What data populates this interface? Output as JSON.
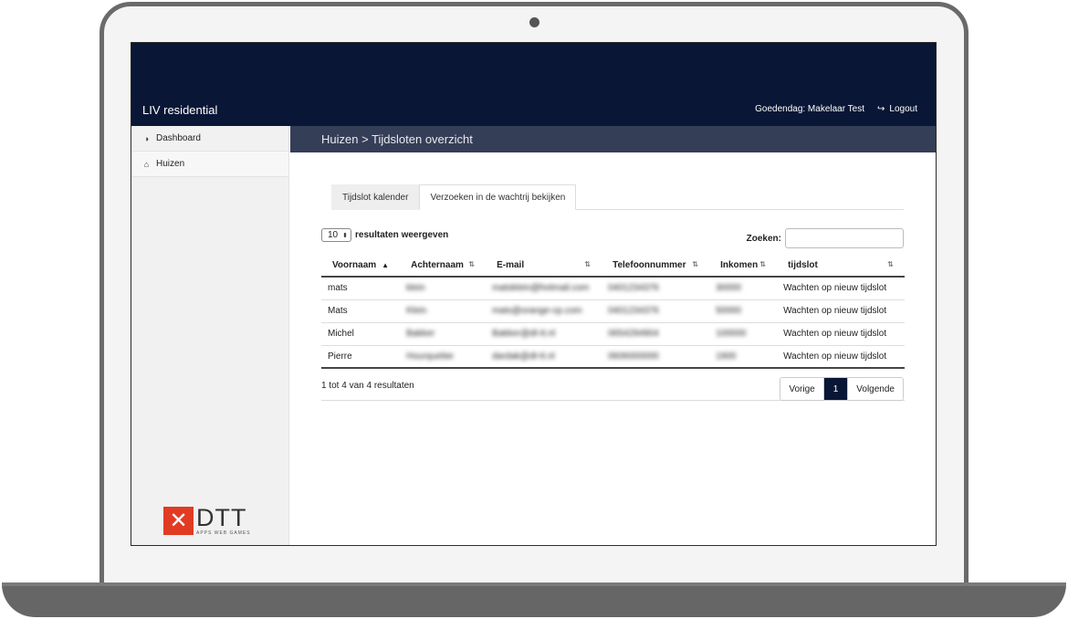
{
  "app": {
    "brand": "LIV residential",
    "greeting": "Goedendag: Makelaar Test",
    "logout_label": "Logout"
  },
  "sidebar": {
    "items": [
      {
        "label": "Dashboard",
        "icon": "dashboard-icon"
      },
      {
        "label": "Huizen",
        "icon": "home-icon"
      }
    ],
    "logo": {
      "text": "DTT",
      "tagline": "APPS WEB GAMES"
    }
  },
  "page": {
    "breadcrumb": "Huizen > Tijdsloten overzicht"
  },
  "tabs": [
    {
      "label": "Tijdslot kalender",
      "active": true
    },
    {
      "label": "Verzoeken in de wachtrij bekijken",
      "active": false
    }
  ],
  "table_controls": {
    "page_length": "10",
    "page_length_label": "resultaten weergeven",
    "search_label": "Zoeken:",
    "search_value": ""
  },
  "table": {
    "columns": [
      "Voornaam",
      "Achternaam",
      "E-mail",
      "Telefoonnummer",
      "Inkomen",
      "tijdslot"
    ],
    "rows": [
      {
        "voornaam": "mats",
        "achternaam": "klein",
        "email": "matsklein@hotmail.com",
        "telefoon": "0401234376",
        "inkomen": "30000",
        "tijdslot": "Wachten op nieuw tijdslot"
      },
      {
        "voornaam": "Mats",
        "achternaam": "Klein",
        "email": "mats@orange-cp.com",
        "telefoon": "0401234376",
        "inkomen": "50000",
        "tijdslot": "Wachten op nieuw tijdslot"
      },
      {
        "voornaam": "Michel",
        "achternaam": "Bakker",
        "email": "Bakker@dt-tt.nl",
        "telefoon": "0654294904",
        "inkomen": "100000",
        "tijdslot": "Wachten op nieuw tijdslot"
      },
      {
        "voornaam": "Pierre",
        "achternaam": "Hourquebie",
        "email": "dardak@dt-tt.nl",
        "telefoon": "0606000000",
        "inkomen": "1900",
        "tijdslot": "Wachten op nieuw tijdslot"
      }
    ]
  },
  "pagination": {
    "info": "1 tot 4 van 4 resultaten",
    "prev": "Vorige",
    "current": "1",
    "next": "Volgende"
  }
}
